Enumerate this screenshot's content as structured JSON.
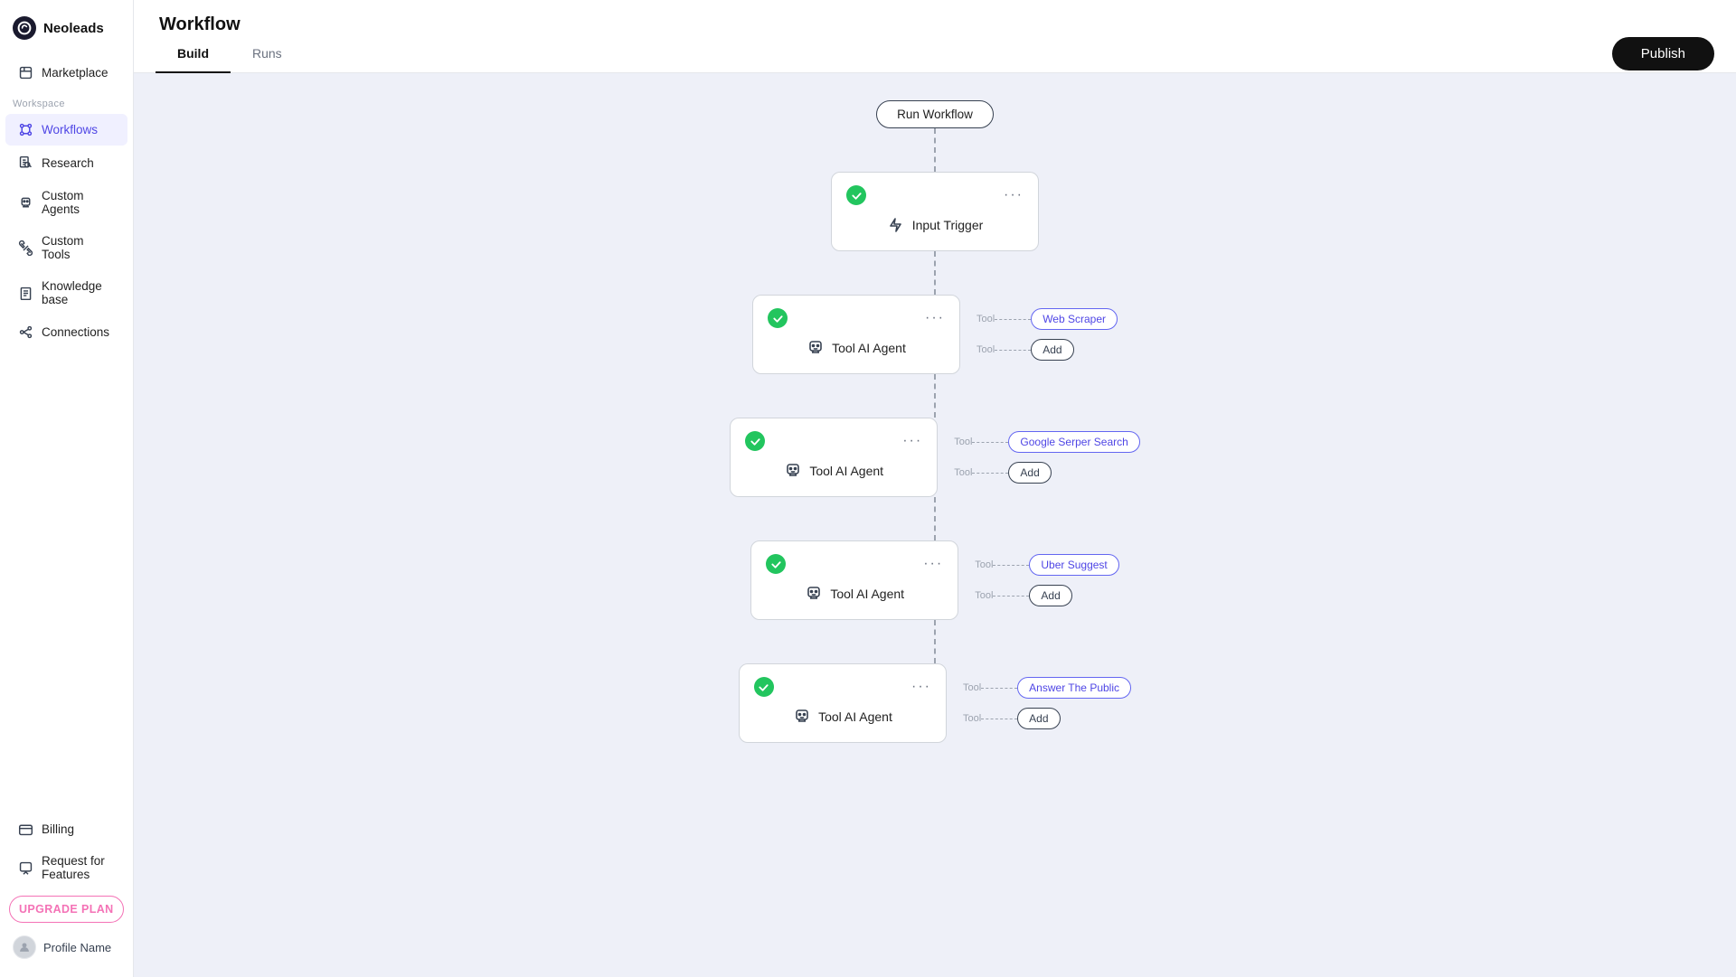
{
  "app": {
    "name": "Neoleads"
  },
  "sidebar": {
    "workspace_label": "Workspace",
    "items": [
      {
        "id": "marketplace",
        "label": "Marketplace",
        "icon": "marketplace-icon"
      },
      {
        "id": "workflows",
        "label": "Workflows",
        "icon": "workflows-icon"
      },
      {
        "id": "research",
        "label": "Research",
        "icon": "research-icon"
      },
      {
        "id": "custom-agents",
        "label": "Custom Agents",
        "icon": "agents-icon"
      },
      {
        "id": "custom-tools",
        "label": "Custom Tools",
        "icon": "tools-icon"
      },
      {
        "id": "knowledge-base",
        "label": "Knowledge base",
        "icon": "knowledge-icon"
      },
      {
        "id": "connections",
        "label": "Connections",
        "icon": "connections-icon"
      }
    ],
    "bottom_items": [
      {
        "id": "billing",
        "label": "Billing",
        "icon": "billing-icon"
      },
      {
        "id": "request-features",
        "label": "Request for Features",
        "icon": "request-icon"
      }
    ],
    "upgrade_label": "UPGRADE PLAN",
    "profile_name": "Profile Name"
  },
  "header": {
    "title": "Workflow",
    "tabs": [
      {
        "id": "build",
        "label": "Build",
        "active": true
      },
      {
        "id": "runs",
        "label": "Runs",
        "active": false
      }
    ],
    "publish_label": "Publish"
  },
  "workflow": {
    "run_button_label": "Run Workflow",
    "nodes": [
      {
        "id": "input-trigger",
        "type": "trigger",
        "label": "Input Trigger",
        "icon": "trigger-icon",
        "checked": true,
        "tools": []
      },
      {
        "id": "tool-agent-1",
        "type": "agent",
        "label": "Tool AI Agent",
        "icon": "agent-icon",
        "checked": true,
        "tools": [
          {
            "label": "Web Scraper",
            "type": "named"
          },
          {
            "label": "Add",
            "type": "add"
          }
        ]
      },
      {
        "id": "tool-agent-2",
        "type": "agent",
        "label": "Tool AI Agent",
        "icon": "agent-icon",
        "checked": true,
        "tools": [
          {
            "label": "Google Serper Search",
            "type": "named"
          },
          {
            "label": "Add",
            "type": "add"
          }
        ]
      },
      {
        "id": "tool-agent-3",
        "type": "agent",
        "label": "Tool AI Agent",
        "icon": "agent-icon",
        "checked": true,
        "tools": [
          {
            "label": "Uber Suggest",
            "type": "named"
          },
          {
            "label": "Add",
            "type": "add"
          }
        ]
      },
      {
        "id": "tool-agent-4",
        "type": "agent",
        "label": "Tool AI Agent",
        "icon": "agent-icon",
        "checked": true,
        "tools": [
          {
            "label": "Answer The Public",
            "type": "named"
          },
          {
            "label": "Add",
            "type": "add"
          }
        ]
      }
    ],
    "tool_prefix": "Tool"
  }
}
